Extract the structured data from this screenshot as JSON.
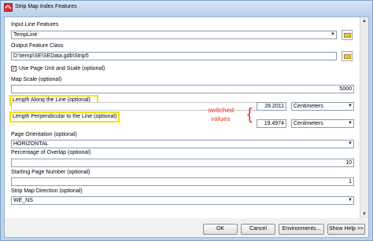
{
  "window": {
    "title": "Strip Map Index Features"
  },
  "params": {
    "input_line": {
      "label": "Input Line Features",
      "value": "TempLine"
    },
    "output_class": {
      "label": "Output Feature Class",
      "value": "D:\\temp\\SE\\SEData.gdb\\Strip5"
    },
    "use_page_unit": {
      "label": "Use Page Unit and Scale (optional)",
      "checked": true
    },
    "map_scale": {
      "label": "Map Scale (optional)",
      "value": "5000"
    },
    "length_along": {
      "label": "Length Along the Line (optional)",
      "value": "28.2011",
      "unit": "Centimeters"
    },
    "length_perp": {
      "label": "Length Perpendicular to the Line (optional)",
      "value": "19.4974",
      "unit": "Centimeters"
    },
    "orientation": {
      "label": "Page Orientation (optional)",
      "value": "HORIZONTAL"
    },
    "overlap": {
      "label": "Percentage of Overlap (optional)",
      "value": "10"
    },
    "start_page": {
      "label": "Starting Page Number (optional)",
      "value": "1"
    },
    "direction": {
      "label": "Strip Map Direction (optional)",
      "value": "WE_NS"
    }
  },
  "annotation": {
    "line1": "switched",
    "line2": "values",
    "color": "#e8342a"
  },
  "buttons": {
    "ok": "OK",
    "cancel": "Cancel",
    "environments": "Environments...",
    "help": "Show Help >>"
  },
  "highlight_color": "#f2e200"
}
